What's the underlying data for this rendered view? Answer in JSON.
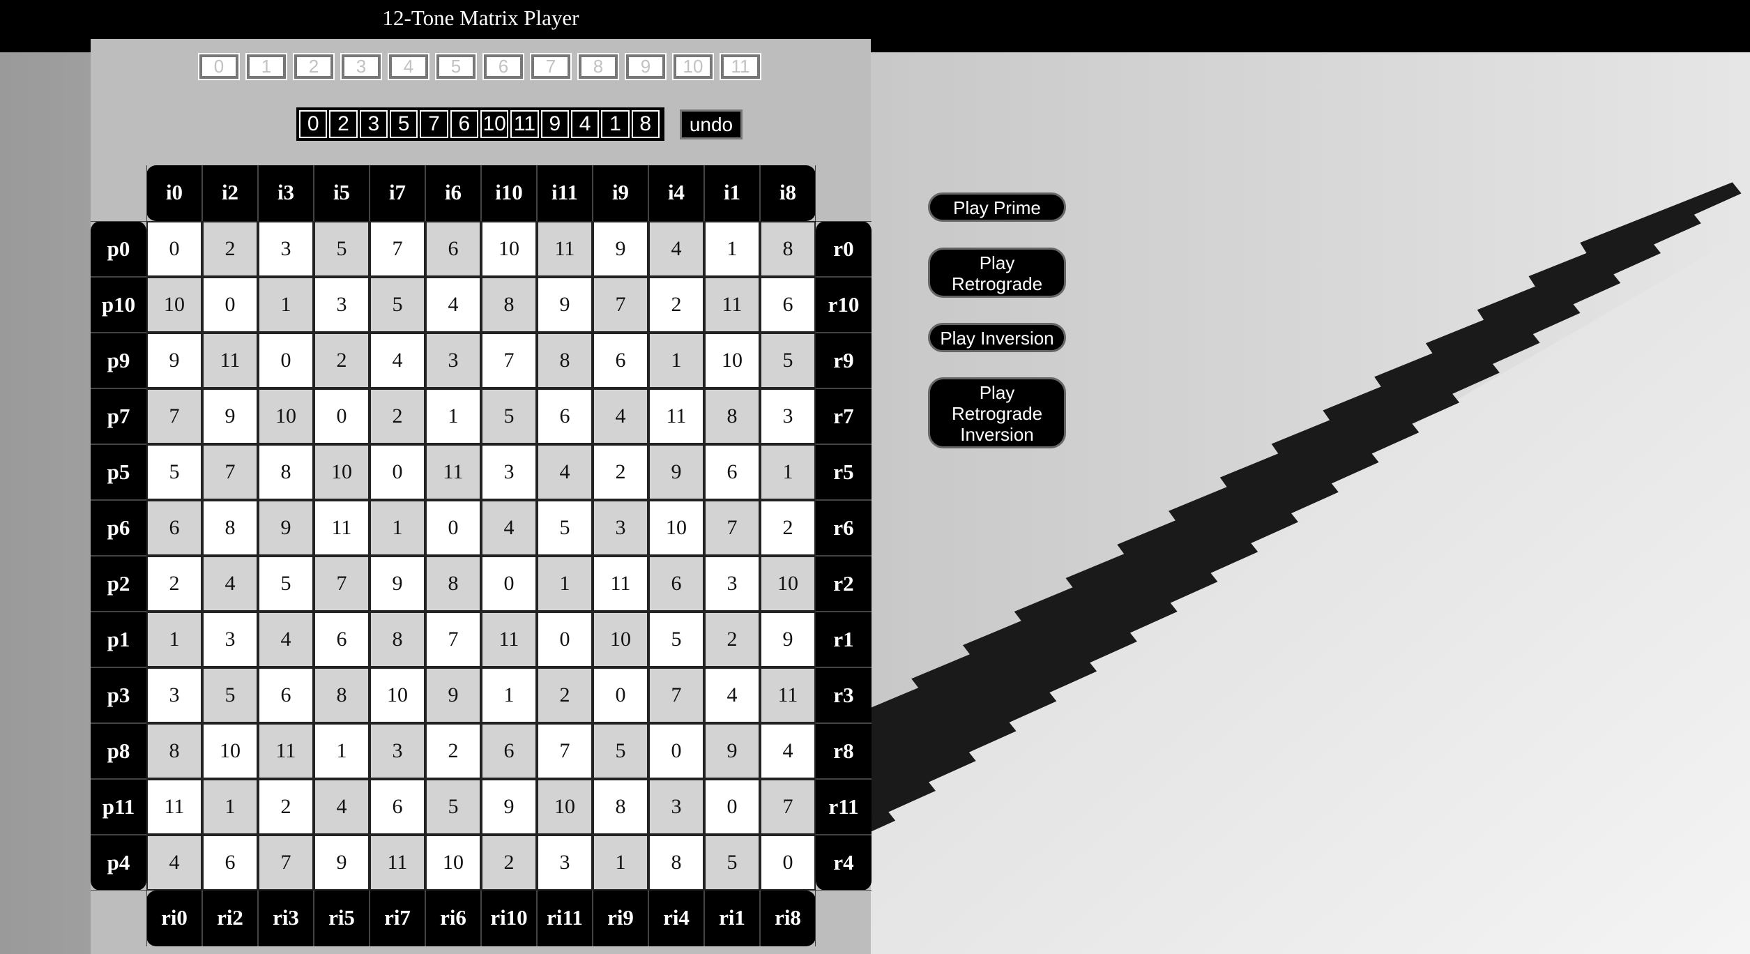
{
  "app": {
    "title": "12-Tone Matrix Player"
  },
  "tone_pool": [
    "0",
    "1",
    "2",
    "3",
    "4",
    "5",
    "6",
    "7",
    "8",
    "9",
    "10",
    "11"
  ],
  "tone_row": [
    "0",
    "2",
    "3",
    "5",
    "7",
    "6",
    "10",
    "11",
    "9",
    "4",
    "1",
    "8"
  ],
  "undo_label": "undo",
  "matrix": {
    "col_headers": [
      "i0",
      "i2",
      "i3",
      "i5",
      "i7",
      "i6",
      "i10",
      "i11",
      "i9",
      "i4",
      "i1",
      "i8"
    ],
    "col_footers": [
      "ri0",
      "ri2",
      "ri3",
      "ri5",
      "ri7",
      "ri6",
      "ri10",
      "ri11",
      "ri9",
      "ri4",
      "ri1",
      "ri8"
    ],
    "row_headers": [
      "p0",
      "p10",
      "p9",
      "p7",
      "p5",
      "p6",
      "p2",
      "p1",
      "p3",
      "p8",
      "p11",
      "p4"
    ],
    "row_tails": [
      "r0",
      "r10",
      "r9",
      "r7",
      "r5",
      "r6",
      "r2",
      "r1",
      "r3",
      "r8",
      "r11",
      "r4"
    ],
    "rows": [
      [
        "0",
        "2",
        "3",
        "5",
        "7",
        "6",
        "10",
        "11",
        "9",
        "4",
        "1",
        "8"
      ],
      [
        "10",
        "0",
        "1",
        "3",
        "5",
        "4",
        "8",
        "9",
        "7",
        "2",
        "11",
        "6"
      ],
      [
        "9",
        "11",
        "0",
        "2",
        "4",
        "3",
        "7",
        "8",
        "6",
        "1",
        "10",
        "5"
      ],
      [
        "7",
        "9",
        "10",
        "0",
        "2",
        "1",
        "5",
        "6",
        "4",
        "11",
        "8",
        "3"
      ],
      [
        "5",
        "7",
        "8",
        "10",
        "0",
        "11",
        "3",
        "4",
        "2",
        "9",
        "6",
        "1"
      ],
      [
        "6",
        "8",
        "9",
        "11",
        "1",
        "0",
        "4",
        "5",
        "3",
        "10",
        "7",
        "2"
      ],
      [
        "2",
        "4",
        "5",
        "7",
        "9",
        "8",
        "0",
        "1",
        "11",
        "6",
        "3",
        "10"
      ],
      [
        "1",
        "3",
        "4",
        "6",
        "8",
        "7",
        "11",
        "0",
        "10",
        "5",
        "2",
        "9"
      ],
      [
        "3",
        "5",
        "6",
        "8",
        "10",
        "9",
        "1",
        "2",
        "0",
        "7",
        "4",
        "11"
      ],
      [
        "8",
        "10",
        "11",
        "1",
        "3",
        "2",
        "6",
        "7",
        "5",
        "0",
        "9",
        "4"
      ],
      [
        "11",
        "1",
        "2",
        "4",
        "6",
        "5",
        "9",
        "10",
        "8",
        "3",
        "0",
        "7"
      ],
      [
        "4",
        "6",
        "7",
        "9",
        "11",
        "10",
        "2",
        "3",
        "1",
        "8",
        "5",
        "0"
      ]
    ]
  },
  "buttons": {
    "play_prime": "Play Prime",
    "play_retrograde": [
      "Play",
      "Retrograde"
    ],
    "play_inversion": "Play Inversion",
    "play_retrograde_inversion": [
      "Play",
      "Retrograde",
      "Inversion"
    ]
  },
  "colors": {
    "header_bg": "#000000",
    "panel_bg": "#bdbdbd",
    "cell_light": "#ffffff",
    "cell_shaded": "#d3d3d3",
    "button_bg": "#000000"
  }
}
